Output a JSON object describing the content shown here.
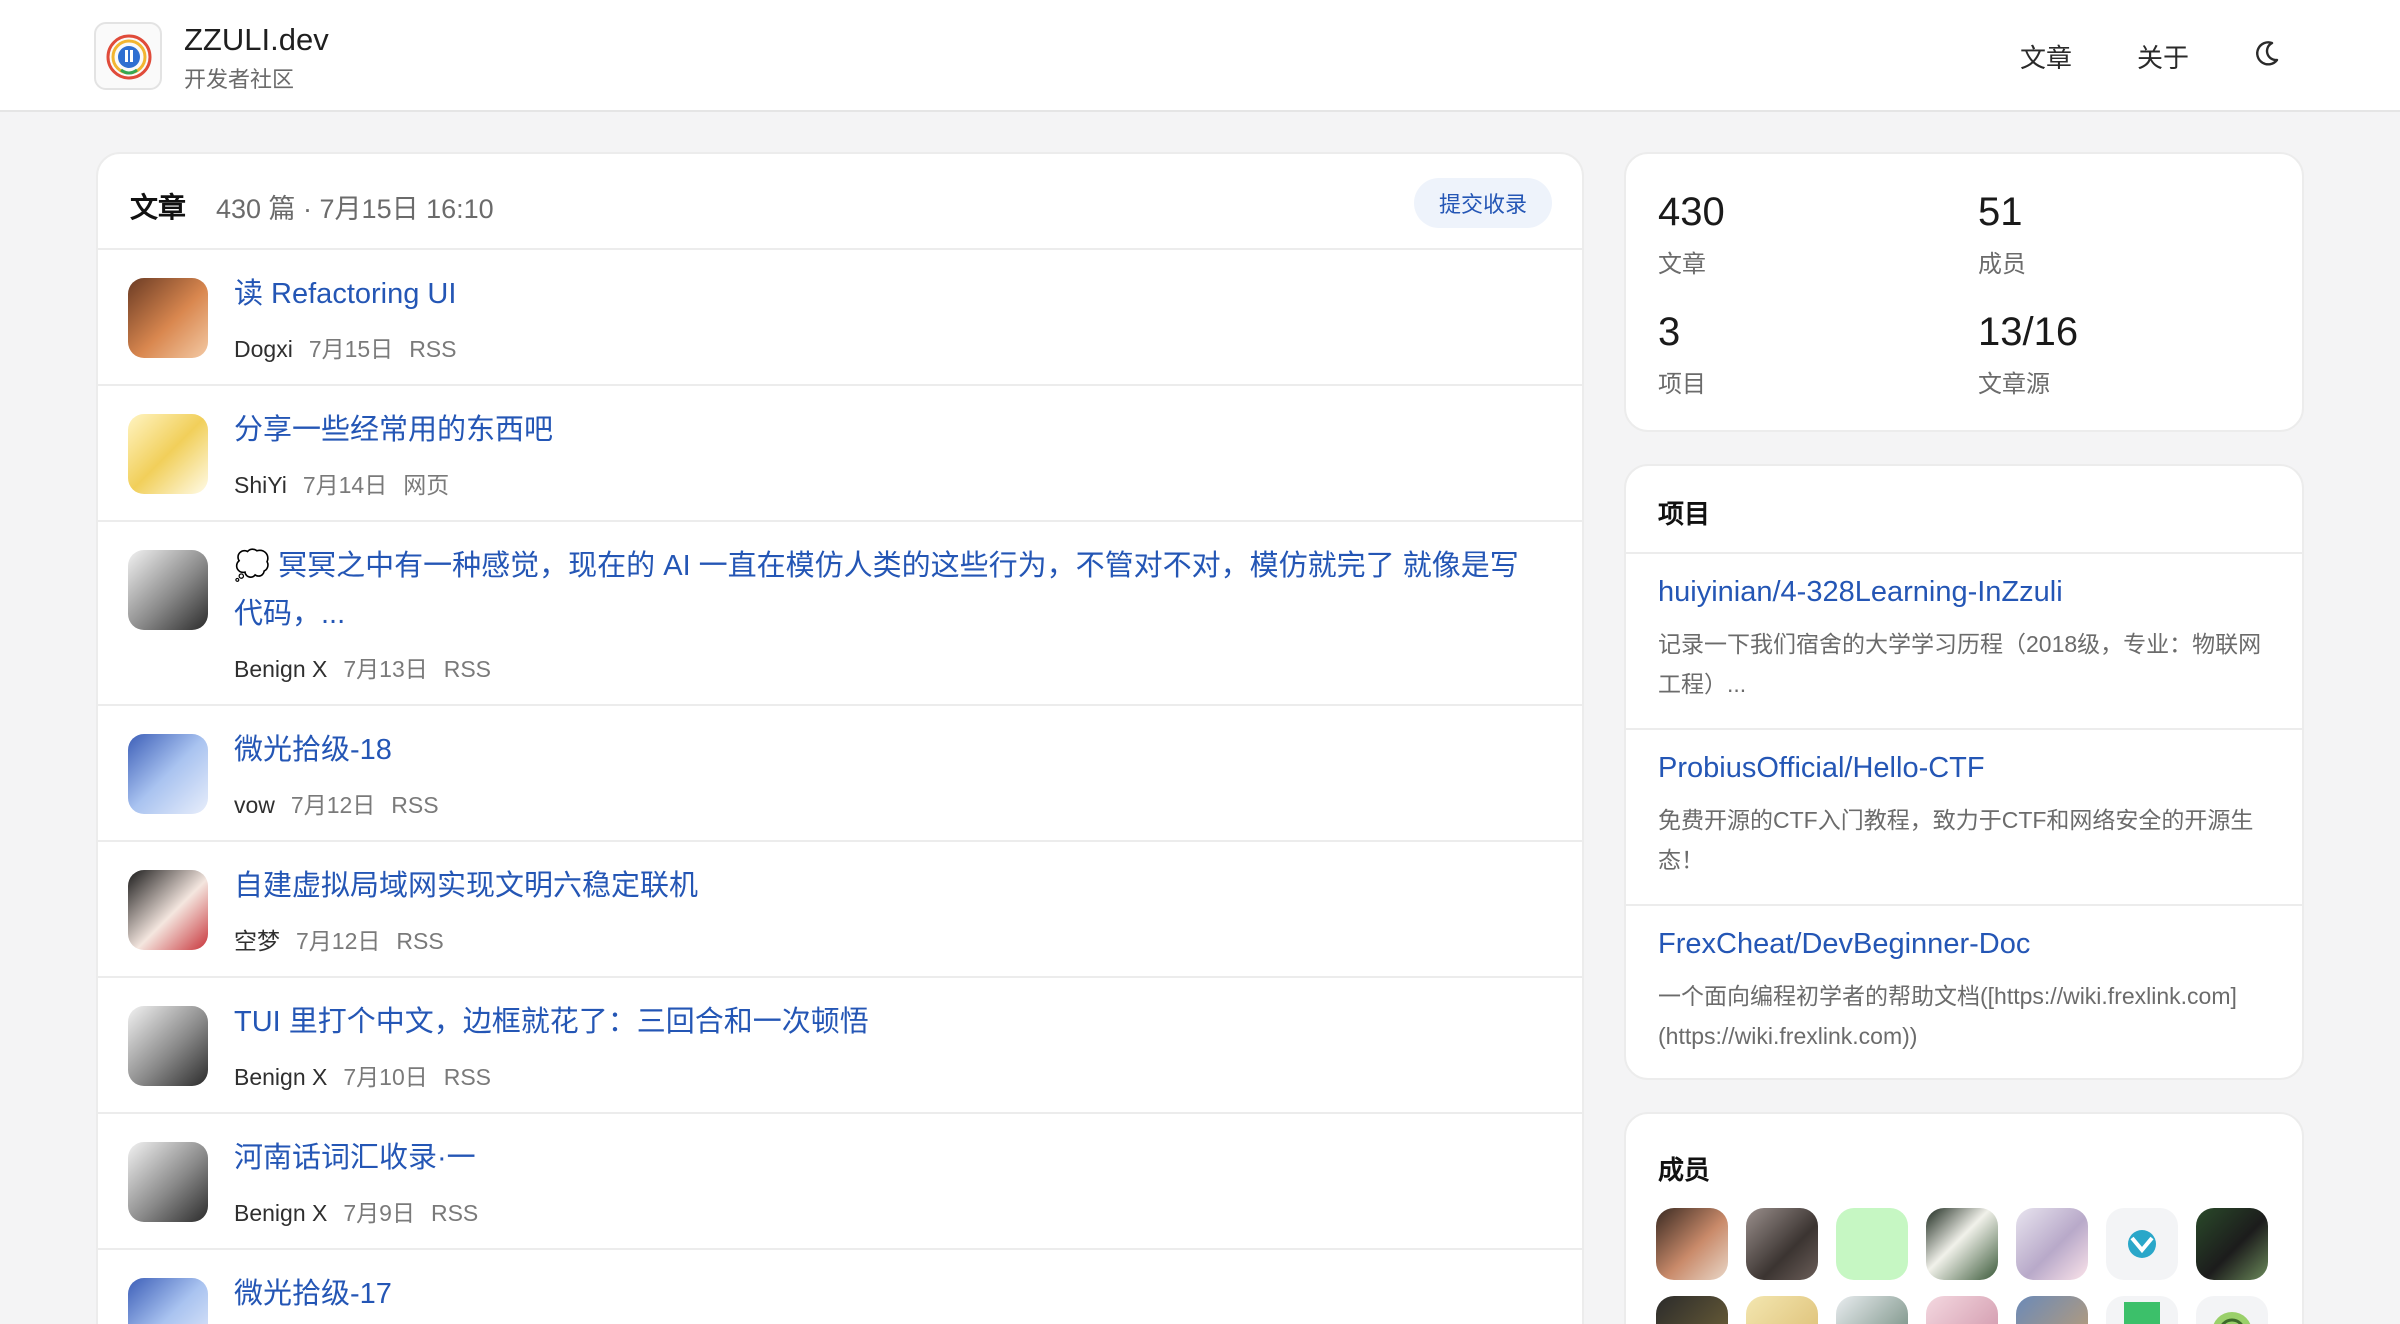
{
  "site": {
    "name": "ZZULI.dev",
    "subtitle": "开发者社区"
  },
  "nav": {
    "articles": "文章",
    "about": "关于",
    "theme_icon": "moon-icon"
  },
  "feed": {
    "title": "文章",
    "meta": "430 篇 · 7月15日 16:10",
    "submit_label": "提交收录",
    "items": [
      {
        "title": "读 Refactoring UI",
        "author": "Dogxi",
        "date": "7月15日",
        "source": "RSS"
      },
      {
        "title": "分享一些经常用的东西吧",
        "author": "ShiYi",
        "date": "7月14日",
        "source": "网页"
      },
      {
        "title": "💭 冥冥之中有一种感觉，现在的 AI 一直在模仿人类的这些行为，不管对不对，模仿就完了 就像是写代码，...",
        "author": "Benign X",
        "date": "7月13日",
        "source": "RSS"
      },
      {
        "title": "微光拾级-18",
        "author": "vow",
        "date": "7月12日",
        "source": "RSS"
      },
      {
        "title": "自建虚拟局域网实现文明六稳定联机",
        "author": "空梦",
        "date": "7月12日",
        "source": "RSS"
      },
      {
        "title": "TUI 里打个中文，边框就花了：三回合和一次顿悟",
        "author": "Benign X",
        "date": "7月10日",
        "source": "RSS"
      },
      {
        "title": "河南话词汇收录·一",
        "author": "Benign X",
        "date": "7月9日",
        "source": "RSS"
      },
      {
        "title": "微光拾级-17",
        "author": "",
        "date": "",
        "source": ""
      }
    ]
  },
  "stats": [
    {
      "value": "430",
      "label": "文章"
    },
    {
      "value": "51",
      "label": "成员"
    },
    {
      "value": "3",
      "label": "项目"
    },
    {
      "value": "13/16",
      "label": "文章源"
    }
  ],
  "projects": {
    "title": "项目",
    "items": [
      {
        "name": "huiyinian/4-328Learning-InZzuli",
        "desc": "记录一下我们宿舍的大学学习历程（2018级，专业：物联网工程）..."
      },
      {
        "name": "ProbiusOfficial/Hello-CTF",
        "desc": "免费开源的CTF入门教程，致力于CTF和网络安全的开源生态！"
      },
      {
        "name": "FrexCheat/DevBeginner-Doc",
        "desc": "一个面向编程初学者的帮助文档([https://wiki.frexlink.com](https://wiki.frexlink.com))"
      }
    ]
  },
  "members": {
    "title": "成员"
  },
  "colors": {
    "link": "#2456b5",
    "background": "#f4f4f5",
    "card": "#ffffff"
  }
}
